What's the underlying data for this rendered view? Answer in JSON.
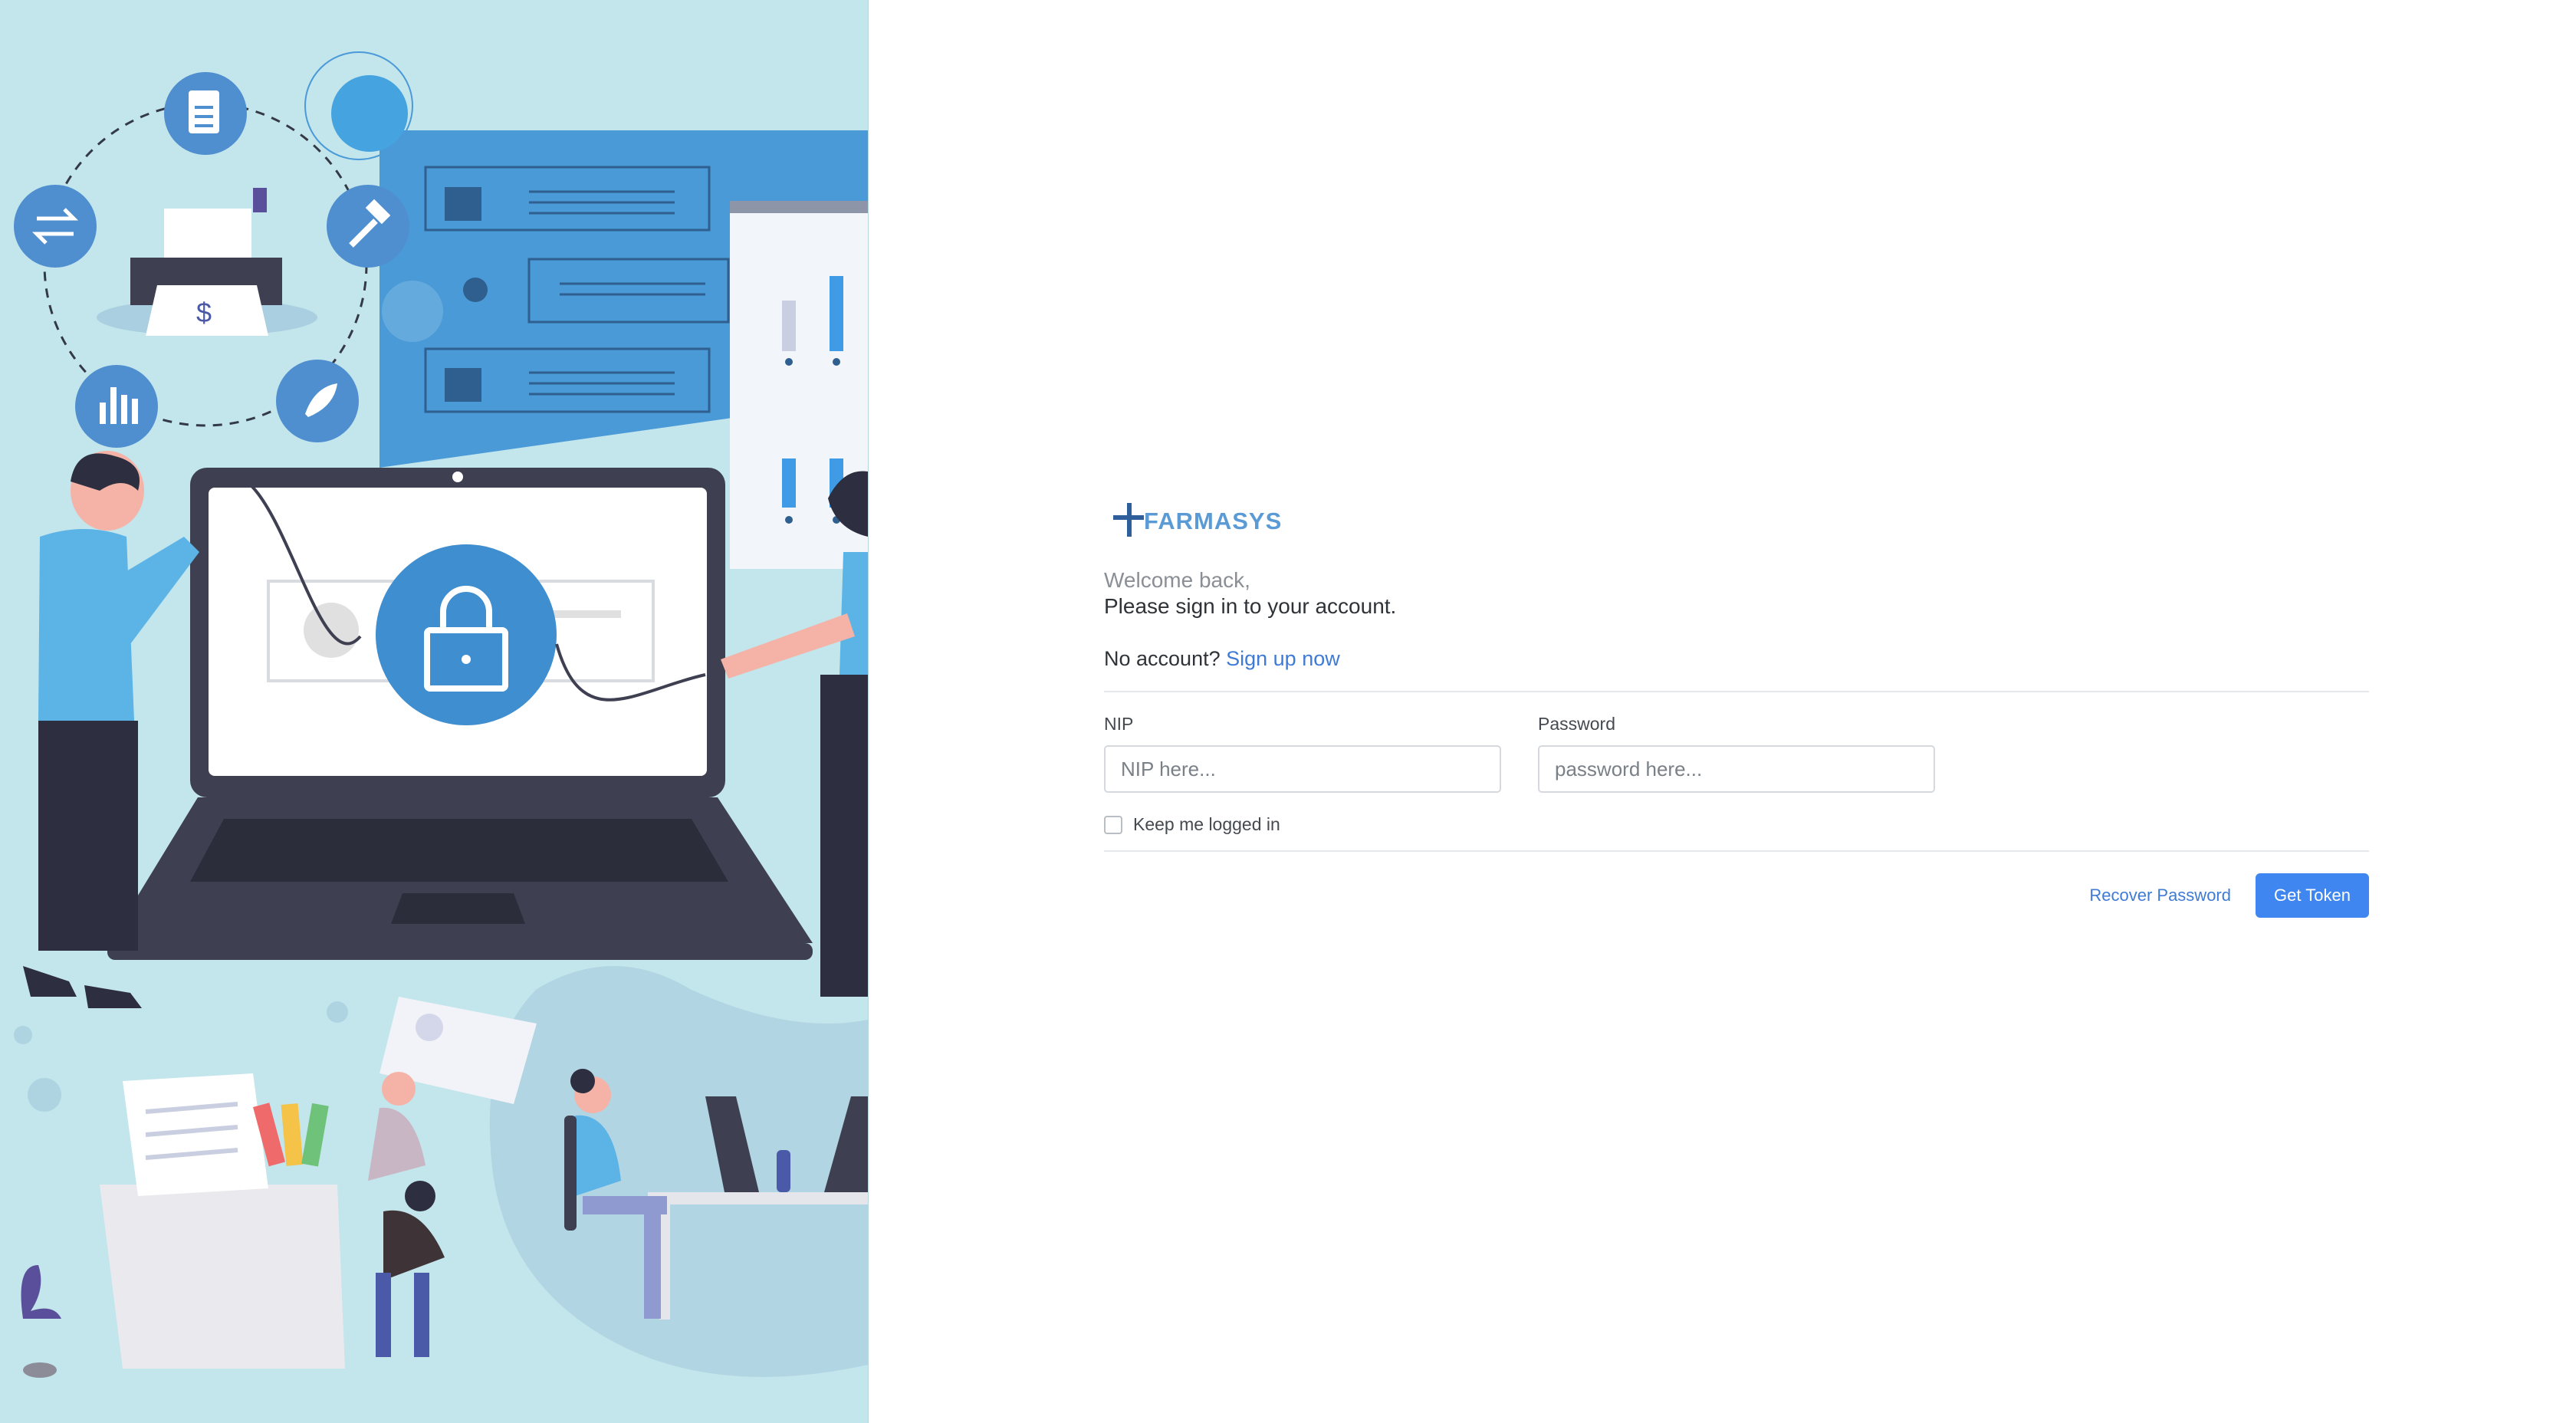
{
  "brand": {
    "name": "FARMASYS",
    "accent": "#5b9bd5"
  },
  "login": {
    "welcome": "Welcome back,",
    "subtitle": "Please sign in to your account.",
    "no_account": "No account?",
    "signup_link": "Sign up now",
    "nip_label": "NIP",
    "nip_placeholder": "NIP here...",
    "password_label": "Password",
    "password_placeholder": "password here...",
    "remember_label": "Keep me logged in",
    "remember_checked": false,
    "recover_link": "Recover Password",
    "submit_label": "Get Token"
  },
  "illustration": {
    "currency_symbol": "$"
  },
  "colors": {
    "primary_button": "#3f86f0",
    "link": "#3f7bd6",
    "illustration_bg": "#c3e5ec"
  }
}
